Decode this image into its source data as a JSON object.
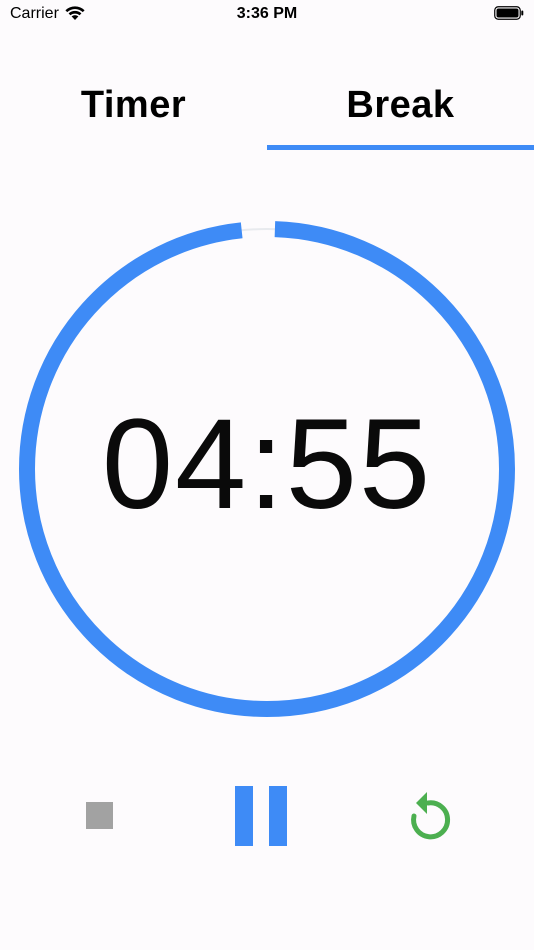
{
  "status_bar": {
    "carrier": "Carrier",
    "time": "3:36 PM",
    "icons": [
      "wifi-icon",
      "battery-icon"
    ]
  },
  "tabs": [
    {
      "label": "Timer",
      "selected": false
    },
    {
      "label": "Break",
      "selected": true
    }
  ],
  "timer": {
    "display": "04:55",
    "progress_fraction": 0.983
  },
  "controls": {
    "stop_icon": "stop-icon",
    "pause_icon": "pause-icon",
    "reset_icon": "reset-icon"
  },
  "colors": {
    "accent": "#3e8bf6",
    "ring_track": "#e8eaee",
    "stop": "#a2a2a2",
    "reset": "#4caf50",
    "background": "#fdfbfd"
  }
}
